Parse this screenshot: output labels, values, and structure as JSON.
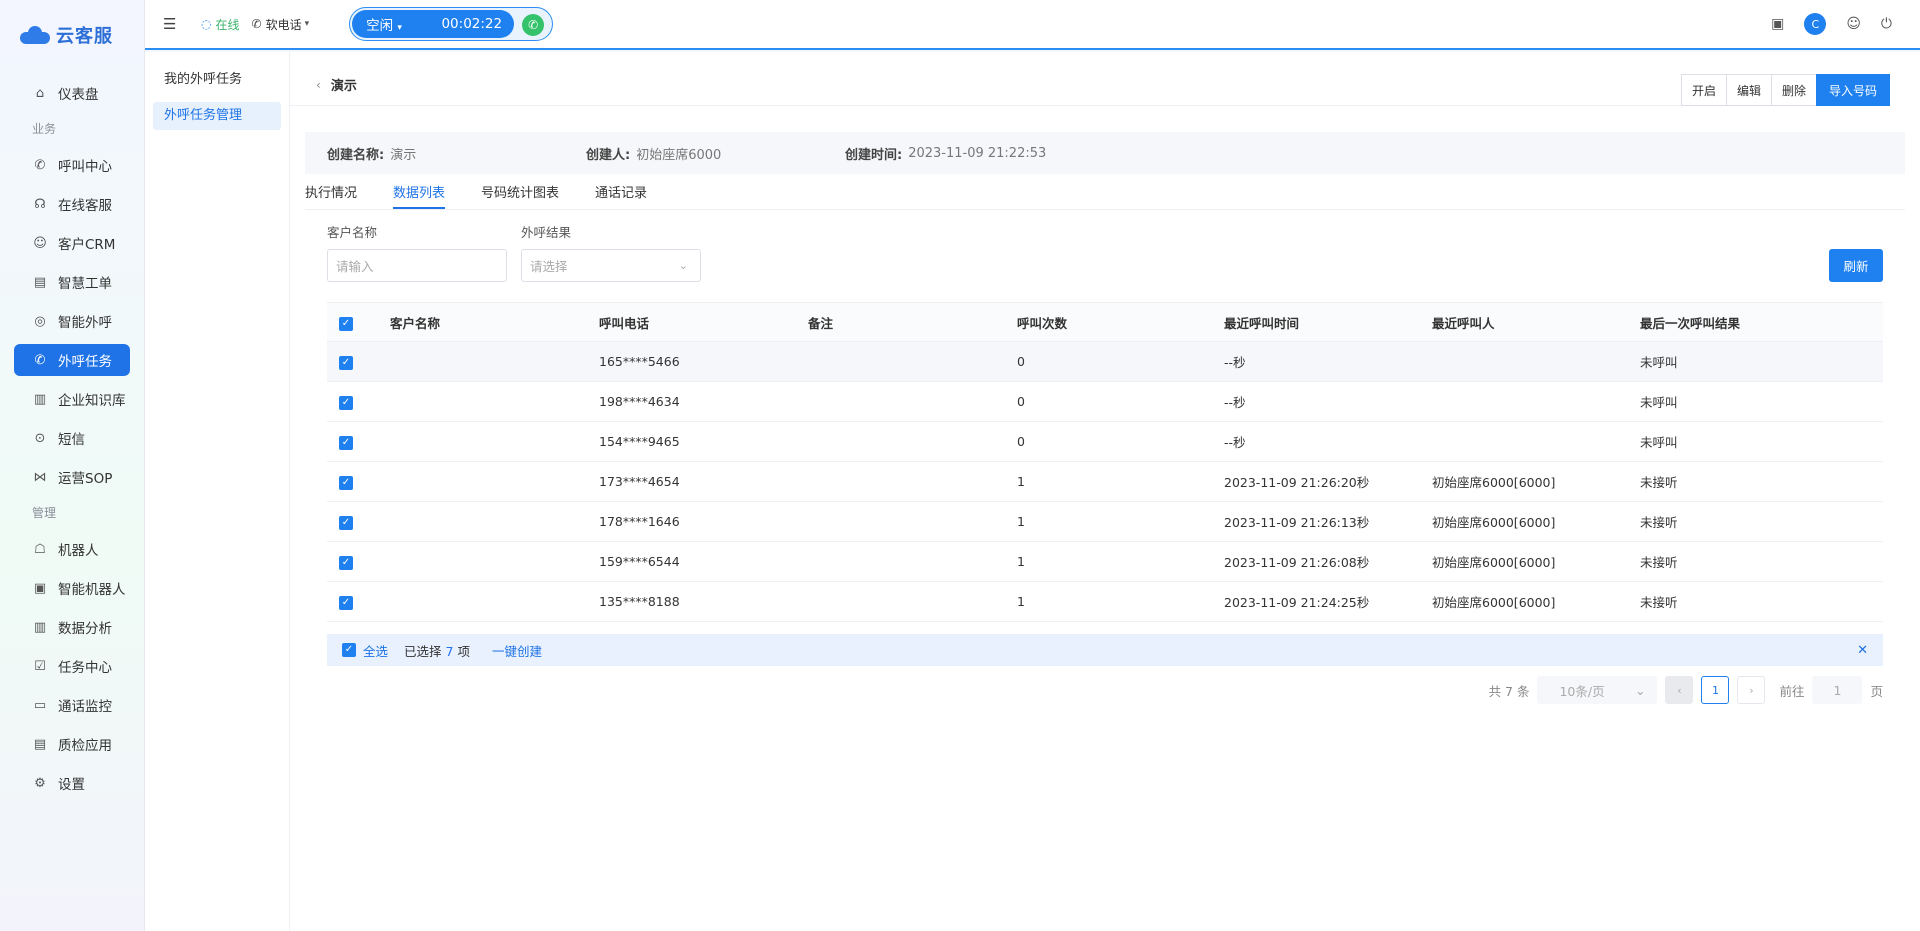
{
  "app": {
    "name": "云客服"
  },
  "sidebar": {
    "items": [
      {
        "type": "item",
        "label": "仪表盘",
        "icon": "home-icon",
        "glyph": "⌂"
      },
      {
        "type": "group",
        "label": "业务"
      },
      {
        "type": "item",
        "label": "呼叫中心",
        "icon": "phone-icon",
        "glyph": "✆"
      },
      {
        "type": "item",
        "label": "在线客服",
        "icon": "headset-icon",
        "glyph": "☊"
      },
      {
        "type": "item",
        "label": "客户CRM",
        "icon": "user-icon",
        "glyph": "☺"
      },
      {
        "type": "item",
        "label": "智慧工单",
        "icon": "document-icon",
        "glyph": "▤"
      },
      {
        "type": "item",
        "label": "智能外呼",
        "icon": "whatsapp-icon",
        "glyph": "◎"
      },
      {
        "type": "item",
        "label": "外呼任务",
        "icon": "outbound-call-icon",
        "glyph": "✆",
        "active": true
      },
      {
        "type": "item",
        "label": "企业知识库",
        "icon": "book-icon",
        "glyph": "▥"
      },
      {
        "type": "item",
        "label": "短信",
        "icon": "message-icon",
        "glyph": "⊙"
      },
      {
        "type": "item",
        "label": "运营SOP",
        "icon": "share-icon",
        "glyph": "⋈"
      },
      {
        "type": "group",
        "label": "管理"
      },
      {
        "type": "item",
        "label": "机器人",
        "icon": "robot-icon",
        "glyph": "☖"
      },
      {
        "type": "item",
        "label": "智能机器人",
        "icon": "smart-robot-icon",
        "glyph": "▣"
      },
      {
        "type": "item",
        "label": "数据分析",
        "icon": "bar-chart-icon",
        "glyph": "▥"
      },
      {
        "type": "item",
        "label": "任务中心",
        "icon": "checklist-icon",
        "glyph": "☑"
      },
      {
        "type": "item",
        "label": "通话监控",
        "icon": "monitor-icon",
        "glyph": "▭"
      },
      {
        "type": "item",
        "label": "质检应用",
        "icon": "inspection-icon",
        "glyph": "▤"
      },
      {
        "type": "item",
        "label": "设置",
        "icon": "settings-icon",
        "glyph": "⚙"
      }
    ]
  },
  "topbar": {
    "status_online": "在线",
    "softphone": "软电话",
    "call_state": "空闲",
    "timer": "00:02:22"
  },
  "subnav": {
    "items": [
      {
        "label": "我的外呼任务",
        "active": false
      },
      {
        "label": "外呼任务管理",
        "active": true
      }
    ]
  },
  "page": {
    "title": "演示",
    "buttons": {
      "start": "开启",
      "edit": "编辑",
      "delete": "删除",
      "import": "导入号码"
    }
  },
  "info": {
    "create_name_label": "创建名称:",
    "create_name": "演示",
    "creator_label": "创建人:",
    "creator": "初始座席6000",
    "create_time_label": "创建时间:",
    "create_time": "2023-11-09 21:22:53"
  },
  "tabs": [
    "执行情况",
    "数据列表",
    "号码统计图表",
    "通话记录"
  ],
  "active_tab": 1,
  "filters": {
    "customer_label": "客户名称",
    "customer_placeholder": "请输入",
    "result_label": "外呼结果",
    "result_placeholder": "请选择",
    "refresh": "刷新"
  },
  "table": {
    "headers": [
      "客户名称",
      "呼叫电话",
      "备注",
      "呼叫次数",
      "最近呼叫时间",
      "最近呼叫人",
      "最后一次呼叫结果"
    ],
    "rows": [
      {
        "name": "",
        "phone": "165****5466",
        "note": "",
        "count": "0",
        "time": "--秒",
        "who": "",
        "result": "未呼叫"
      },
      {
        "name": "",
        "phone": "198****4634",
        "note": "",
        "count": "0",
        "time": "--秒",
        "who": "",
        "result": "未呼叫"
      },
      {
        "name": "",
        "phone": "154****9465",
        "note": "",
        "count": "0",
        "time": "--秒",
        "who": "",
        "result": "未呼叫"
      },
      {
        "name": "",
        "phone": "173****4654",
        "note": "",
        "count": "1",
        "time": "2023-11-09 21:26:20秒",
        "who": "初始座席6000[6000]",
        "result": "未接听"
      },
      {
        "name": "",
        "phone": "178****1646",
        "note": "",
        "count": "1",
        "time": "2023-11-09 21:26:13秒",
        "who": "初始座席6000[6000]",
        "result": "未接听"
      },
      {
        "name": "",
        "phone": "159****6544",
        "note": "",
        "count": "1",
        "time": "2023-11-09 21:26:08秒",
        "who": "初始座席6000[6000]",
        "result": "未接听"
      },
      {
        "name": "",
        "phone": "135****8188",
        "note": "",
        "count": "1",
        "time": "2023-11-09 21:24:25秒",
        "who": "初始座席6000[6000]",
        "result": "未接听"
      }
    ]
  },
  "selection": {
    "select_all": "全选",
    "selected_prefix": "已选择",
    "selected_count": "7",
    "selected_suffix": "项",
    "one_click_create": "一键创建"
  },
  "pagination": {
    "total": "共 7 条",
    "page_size": "10条/页",
    "current_page": "1",
    "goto_label": "前往",
    "goto_value": "1",
    "page_unit": "页"
  },
  "colors": {
    "accent": "#1f80f0",
    "online": "#3bb26b",
    "call_button": "#34c26b"
  }
}
